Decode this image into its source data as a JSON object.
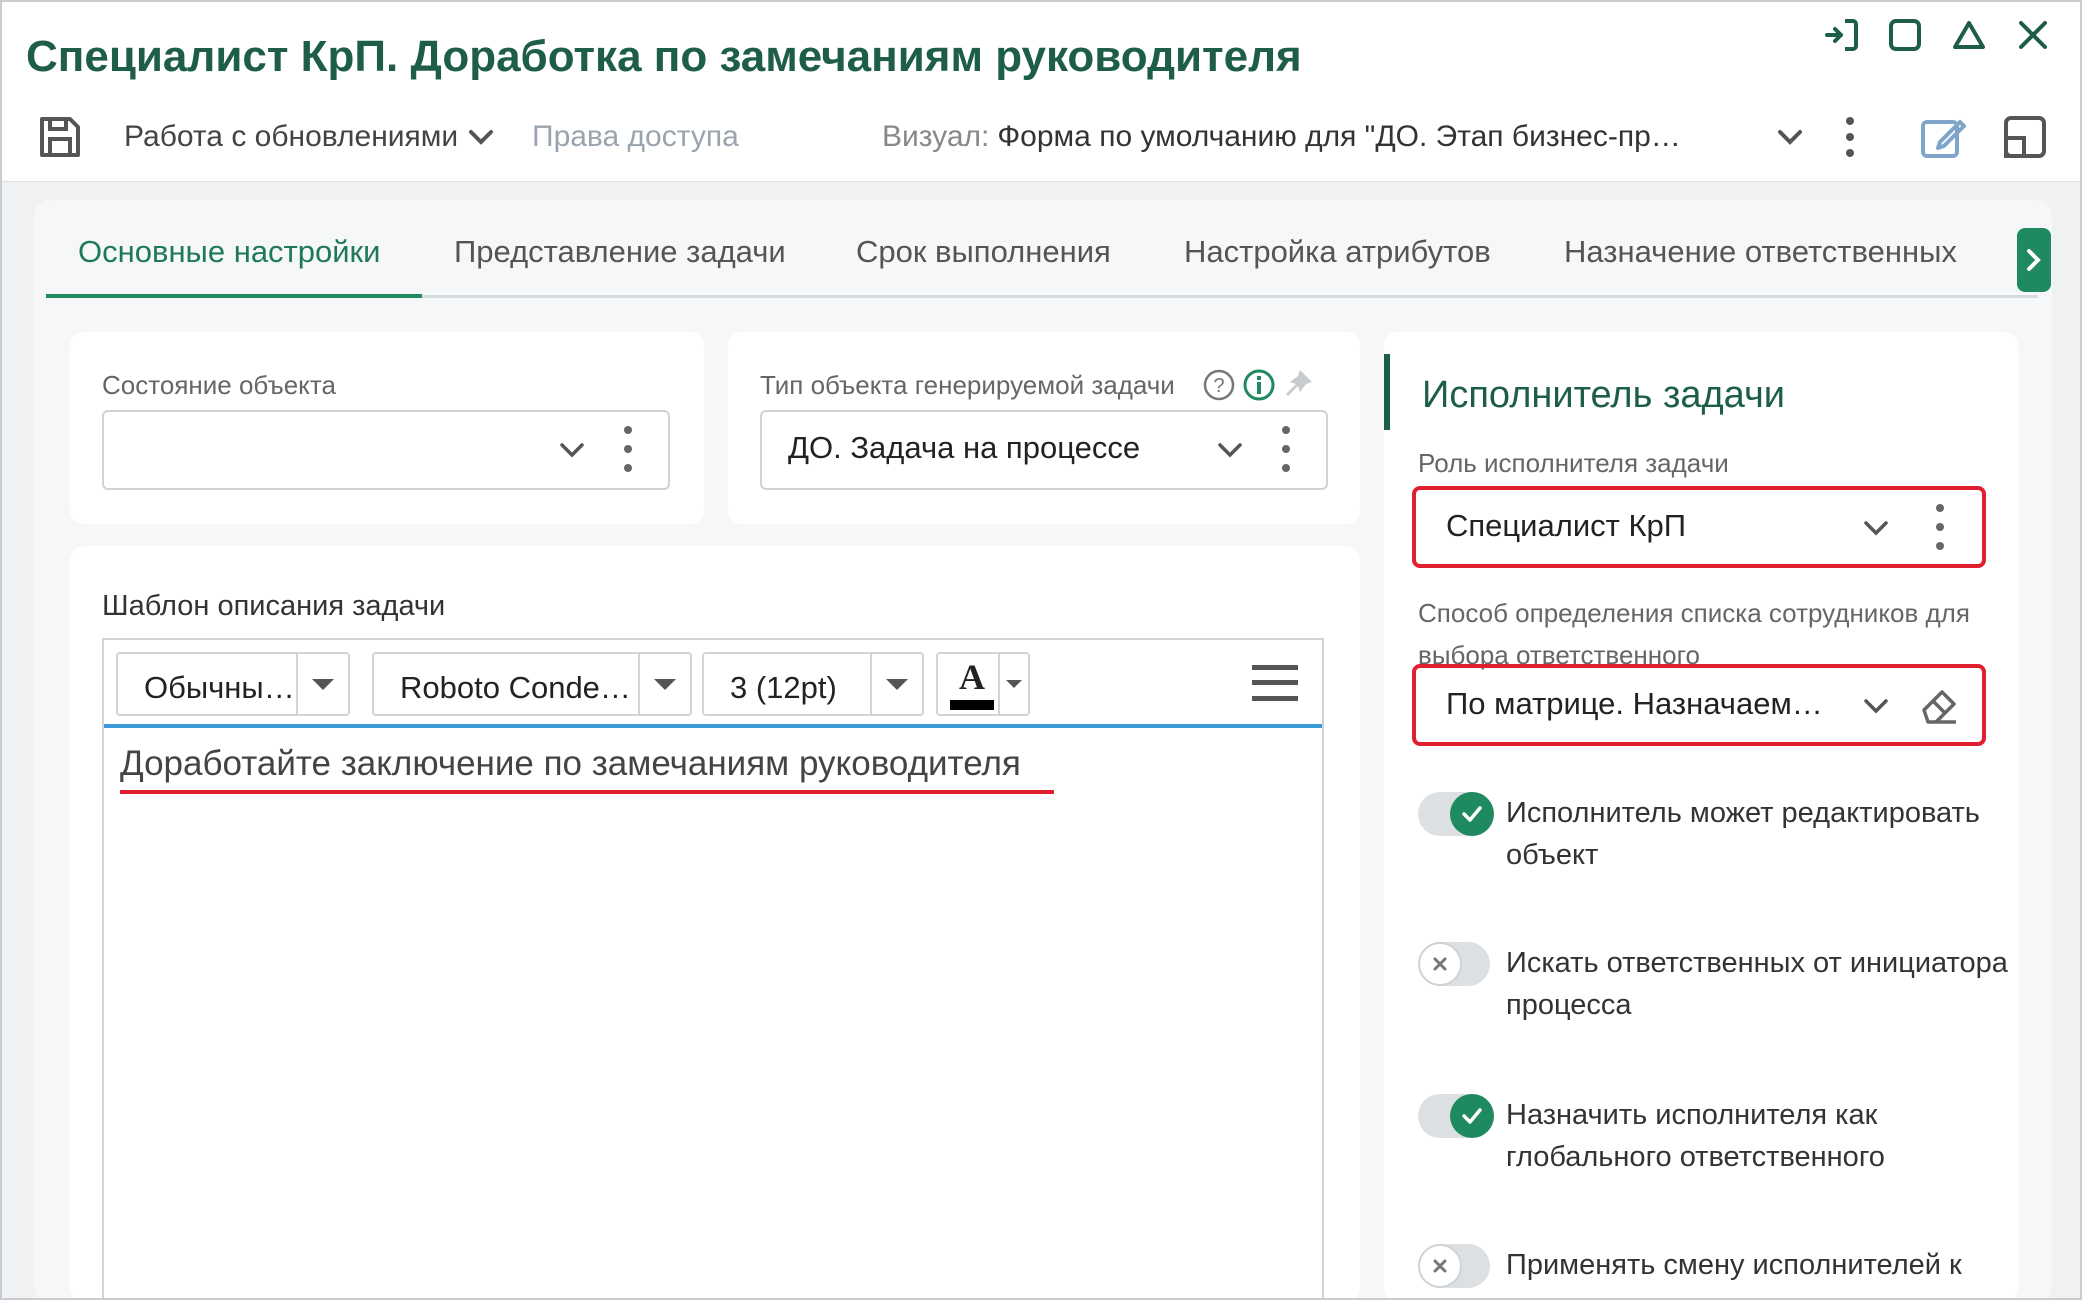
{
  "window": {
    "title": "Специалист КрП. Доработка по замечаниям руководителя"
  },
  "toolbar": {
    "updates_menu_label": "Работа с обновлениями",
    "access_rights_label": "Права доступа",
    "visual_label": "Визуал:",
    "visual_value": "Форма по умолчанию для \"ДО. Этап бизнес-пр…"
  },
  "tabs": [
    {
      "label": "Основные настройки",
      "active": true
    },
    {
      "label": "Представление задачи"
    },
    {
      "label": "Срок выполнения"
    },
    {
      "label": "Настройка атрибутов"
    },
    {
      "label": "Назначение ответственных"
    }
  ],
  "object_state": {
    "label": "Состояние объекта",
    "value": ""
  },
  "task_type": {
    "label": "Тип объекта генерируемой задачи",
    "value": "ДО. Задача на процессе"
  },
  "template": {
    "label": "Шаблон описания задачи",
    "style_select": "Обычны…",
    "font_select": "Roboto Conde…",
    "size_select": "3 (12pt)",
    "font_color_glyph": "A",
    "content": "Доработайте заключение по замечаниям руководителя"
  },
  "executor": {
    "section_title": "Исполнитель задачи",
    "role_label": "Роль исполнителя задачи",
    "role_value": "Специалист КрП",
    "method_label": "Способ определения списка сотрудников для выбора ответственного",
    "method_value": "По матрице. Назначаем…",
    "toggles": [
      {
        "label": "Исполнитель может редактировать объект",
        "on": true
      },
      {
        "label": "Искать ответственных от инициатора процесса",
        "on": false
      },
      {
        "label": "Назначить исполнителя как глобального ответственного",
        "on": true
      },
      {
        "label": "Применять смену исполнителей к",
        "on": false
      }
    ]
  },
  "colors": {
    "accent": "#1f8a5f",
    "title": "#1e5e48",
    "highlight": "#e0202e",
    "editor_border": "#3a9ad6"
  },
  "icons": {
    "save": "save-icon",
    "pin": "pin-icon",
    "help": "help-icon",
    "info": "info-icon",
    "edit": "edit-icon",
    "layout": "layout-icon",
    "eraser": "eraser-icon"
  }
}
